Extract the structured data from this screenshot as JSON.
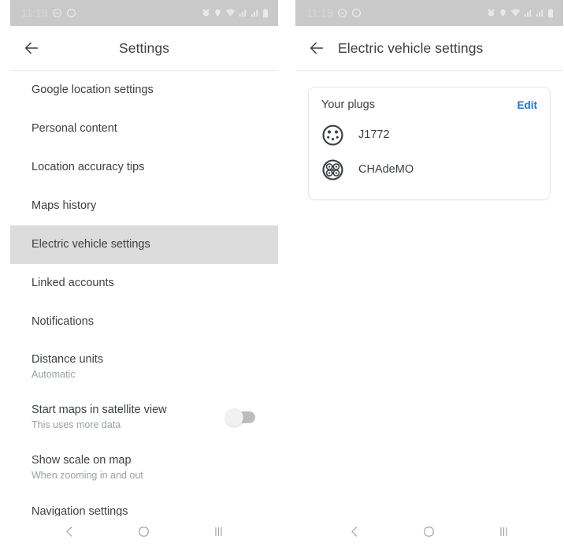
{
  "status_bar": {
    "time": "11:19",
    "left_icons": [
      "do-not-disturb-icon",
      "record-icon"
    ],
    "right_icons": [
      "alarm-icon",
      "location-pin-icon",
      "wifi-icon",
      "signal-icon",
      "signal-icon",
      "battery-icon"
    ]
  },
  "colors": {
    "status_bar_bg": "#c9c9c9",
    "selected_row_bg": "#dcdcdc",
    "link_blue": "#1a73e8",
    "primary_text": "#3c4043",
    "secondary_text": "#9aa0a6"
  },
  "left_screen": {
    "title": "Settings",
    "back_label": "Back",
    "items": [
      {
        "title": "Google location settings",
        "subtitle": "",
        "selected": false,
        "toggle": null
      },
      {
        "title": "Personal content",
        "subtitle": "",
        "selected": false,
        "toggle": null
      },
      {
        "title": "Location accuracy tips",
        "subtitle": "",
        "selected": false,
        "toggle": null
      },
      {
        "title": "Maps history",
        "subtitle": "",
        "selected": false,
        "toggle": null
      },
      {
        "title": "Electric vehicle settings",
        "subtitle": "",
        "selected": true,
        "toggle": null
      },
      {
        "title": "Linked accounts",
        "subtitle": "",
        "selected": false,
        "toggle": null
      },
      {
        "title": "Notifications",
        "subtitle": "",
        "selected": false,
        "toggle": null
      },
      {
        "title": "Distance units",
        "subtitle": "Automatic",
        "selected": false,
        "toggle": null
      },
      {
        "title": "Start maps in satellite view",
        "subtitle": "This uses more data",
        "selected": false,
        "toggle": "off"
      },
      {
        "title": "Show scale on map",
        "subtitle": "When zooming in and out",
        "selected": false,
        "toggle": null
      },
      {
        "title": "Navigation settings",
        "subtitle": "",
        "selected": false,
        "toggle": null
      }
    ]
  },
  "right_screen": {
    "title": "Electric vehicle settings",
    "back_label": "Back",
    "card": {
      "title": "Your plugs",
      "action_label": "Edit",
      "plugs": [
        {
          "label": "J1772",
          "icon": "j1772-plug-icon"
        },
        {
          "label": "CHAdeMO",
          "icon": "chademo-plug-icon"
        }
      ]
    }
  },
  "nav_bar": {
    "buttons": [
      {
        "name": "back-nav-button",
        "icon": "chevron-left-icon"
      },
      {
        "name": "home-nav-button",
        "icon": "circle-icon"
      },
      {
        "name": "recents-nav-button",
        "icon": "bars-icon"
      }
    ]
  }
}
